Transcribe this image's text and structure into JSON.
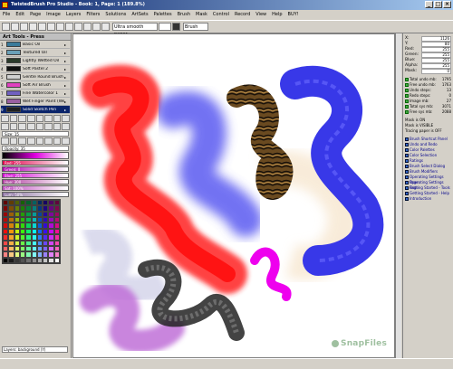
{
  "window": {
    "title": "TwistedBrush Pro Studio - Book: 1, Page: 1 (189.8%)"
  },
  "menu": [
    "File",
    "Edit",
    "Page",
    "Image",
    "Layers",
    "Filters",
    "Solutions",
    "ArtSets",
    "Palettes",
    "Brush",
    "Mask",
    "Control",
    "Record",
    "View",
    "Help",
    "BUY!"
  ],
  "toolbar": {
    "paper": "Ultra smooth paper",
    "brush": "Brush"
  },
  "left": {
    "title": "Art Tools - Press",
    "brushes": [
      {
        "num": "1",
        "label": "Basic Oil",
        "color": "#3a7a9a"
      },
      {
        "num": "2",
        "label": "Textured Oil",
        "color": "#6aa0b8"
      },
      {
        "num": "3",
        "label": "Lightly Wetted Oil",
        "color": "#2a3a2a"
      },
      {
        "num": "4",
        "label": "Soft Pastel 2",
        "color": "#101010"
      },
      {
        "num": "5",
        "label": "Gentle Round Brush",
        "color": "#d0d0d0"
      },
      {
        "num": "6",
        "label": "Soft Air Brush",
        "color": "#e040c0"
      },
      {
        "num": "7",
        "label": "Fine Watercolor 1",
        "color": "#7060c0"
      },
      {
        "num": "8",
        "label": "Wet Finger Paint (Wet)",
        "color": "#9a60a0"
      },
      {
        "num": "9",
        "label": "Solid Sketch Pen",
        "color": "#202020"
      }
    ],
    "size_label": "Size: 15",
    "opacity_label": "Opacity: 35",
    "colors": [
      {
        "label": "Red: 255",
        "color": "#e0004a"
      },
      {
        "label": "Green: 0",
        "color": "#b000b0"
      },
      {
        "label": "Blue: 255",
        "color": "#d000d0"
      },
      {
        "label": "Hue: 300",
        "color": "#b040a0"
      },
      {
        "label": "Sat: 100%",
        "color": "#c050c0"
      },
      {
        "label": "Lum: 50%",
        "color": "#8a70a0"
      }
    ],
    "layer": "Layers: background (Y)"
  },
  "right": {
    "info": [
      {
        "k": "X:",
        "v": "1126"
      },
      {
        "k": "Y:",
        "v": "80"
      },
      {
        "k": "Red:",
        "v": "255"
      },
      {
        "k": "Green:",
        "v": "255"
      },
      {
        "k": "Blue:",
        "v": "255"
      },
      {
        "k": "Alpha:",
        "v": "255"
      },
      {
        "k": "Mask:",
        "v": "0"
      }
    ],
    "stats": [
      {
        "k": "Total undo mb:",
        "v": "1795"
      },
      {
        "k": "Free undo mb:",
        "v": "1763"
      },
      {
        "k": "Undo steps:",
        "v": "13"
      },
      {
        "k": "Redo steps:",
        "v": "0"
      },
      {
        "k": "Image mb:",
        "v": "27"
      },
      {
        "k": "Total sys mb:",
        "v": "3071"
      },
      {
        "k": "Free sys mb:",
        "v": "2088"
      }
    ],
    "plain": [
      "Mask is ON",
      "Mask is VISIBLE",
      "Tracing paper is OFF"
    ],
    "links": [
      "Brush Shortcut Panel",
      "Undo and Redo",
      "Color Palettes",
      "Color Selection",
      "Ratings",
      "Brush Select Dialog",
      "Brush Modifiers",
      "Operating Settings Page",
      "Operating Settings Page",
      "Getting Started - Tools",
      "Getting Started - Help",
      "Introduction"
    ]
  },
  "watermark": "SnapFiles"
}
